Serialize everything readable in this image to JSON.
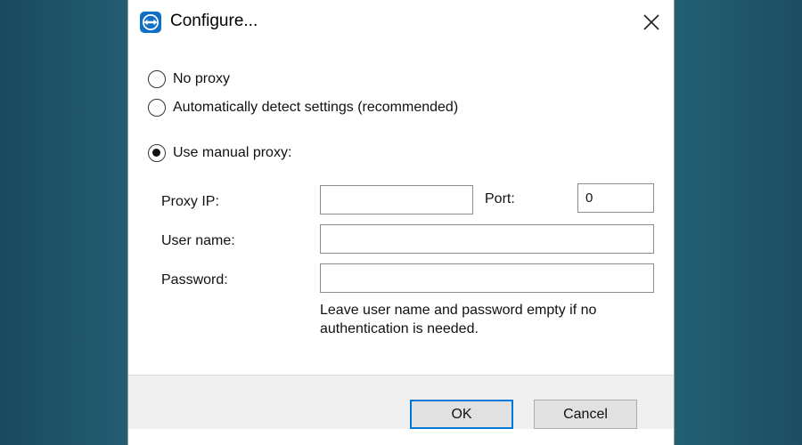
{
  "window": {
    "title": "Configure...",
    "app_icon": "teamviewer-icon",
    "close_icon": "close-icon"
  },
  "proxy_options": {
    "no_proxy": {
      "label": "No proxy",
      "checked": false
    },
    "auto_detect": {
      "label": "Automatically detect settings (recommended)",
      "checked": false
    },
    "manual": {
      "label": "Use manual proxy:",
      "checked": true
    }
  },
  "manual_proxy": {
    "proxy_ip_label": "Proxy IP:",
    "proxy_ip_value": "",
    "port_label": "Port:",
    "port_value": "0",
    "username_label": "User name:",
    "username_value": "",
    "password_label": "Password:",
    "password_value": "",
    "hint": "Leave user name and password empty if no authentication is needed."
  },
  "buttons": {
    "ok": "OK",
    "cancel": "Cancel"
  },
  "colors": {
    "accent": "#0078d7",
    "app_icon_bg": "#0e6fc4"
  }
}
